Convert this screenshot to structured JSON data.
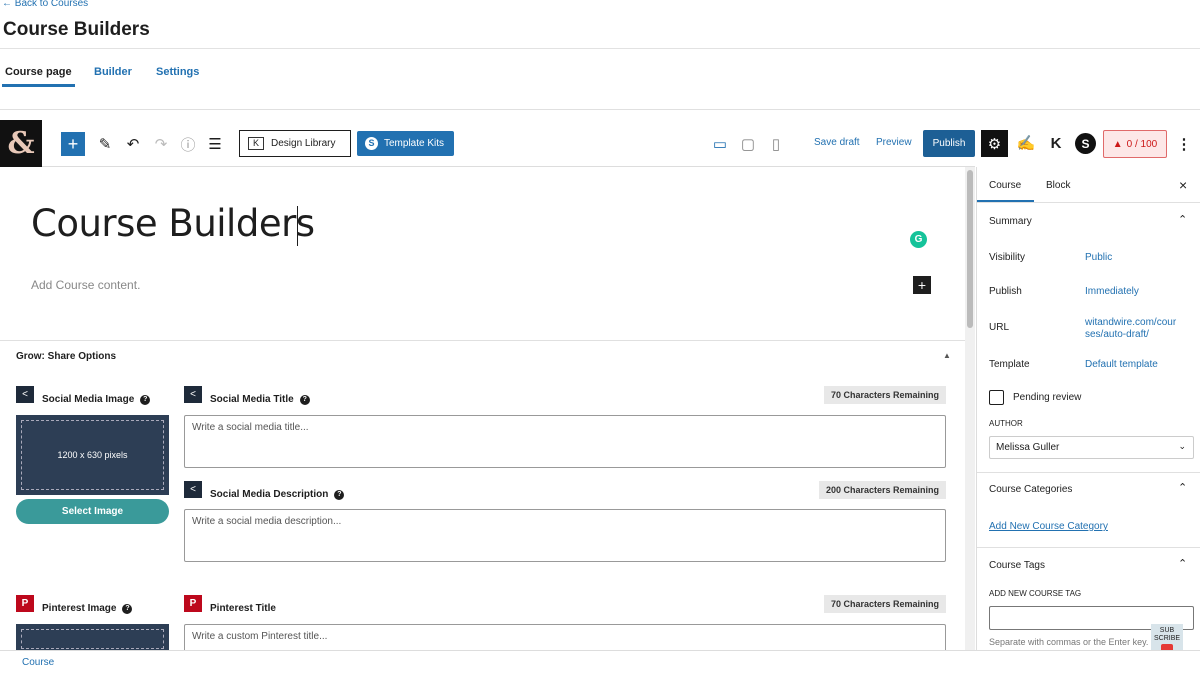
{
  "header": {
    "back": "← Back to Courses",
    "title": "Course Builders",
    "tabs": [
      "Course page",
      "Builder",
      "Settings"
    ]
  },
  "toolbar": {
    "logo": "&",
    "design_library": "Design Library",
    "template_kits": "Template Kits",
    "save_draft": "Save draft",
    "preview": "Preview",
    "publish": "Publish",
    "score": "0 / 100"
  },
  "editor": {
    "title": "Course Builders",
    "placeholder": "Add Course content."
  },
  "grow": {
    "heading": "Grow: Share Options",
    "social_image_label": "Social Media Image",
    "image_size": "1200 x 630 pixels",
    "select_image": "Select Image",
    "social_title_label": "Social Media Title",
    "social_title_remaining": "70 Characters Remaining",
    "social_title_placeholder": "Write a social media title...",
    "social_desc_label": "Social Media Description",
    "social_desc_remaining": "200 Characters Remaining",
    "social_desc_placeholder": "Write a social media description...",
    "pinterest_image_label": "Pinterest Image",
    "pinterest_title_label": "Pinterest Title",
    "pinterest_title_remaining": "70 Characters Remaining",
    "pinterest_title_placeholder": "Write a custom Pinterest title..."
  },
  "sidebar": {
    "tabs": [
      "Course",
      "Block"
    ],
    "summary": "Summary",
    "visibility_label": "Visibility",
    "visibility": "Public",
    "publish_label": "Publish",
    "publish": "Immediately",
    "url_label": "URL",
    "url": "witandwire.com/courses/auto-draft/",
    "template_label": "Template",
    "template": "Default template",
    "pending": "Pending review",
    "author_label": "AUTHOR",
    "author": "Melissa Guller",
    "categories": "Course Categories",
    "add_category": "Add New Course Category",
    "tags": "Course Tags",
    "add_tag_label": "ADD NEW COURSE TAG",
    "tag_help": "Separate with commas or the Enter key.",
    "subscribe": "SUB SCRIBE"
  },
  "footer": {
    "breadcrumb": "Course"
  }
}
